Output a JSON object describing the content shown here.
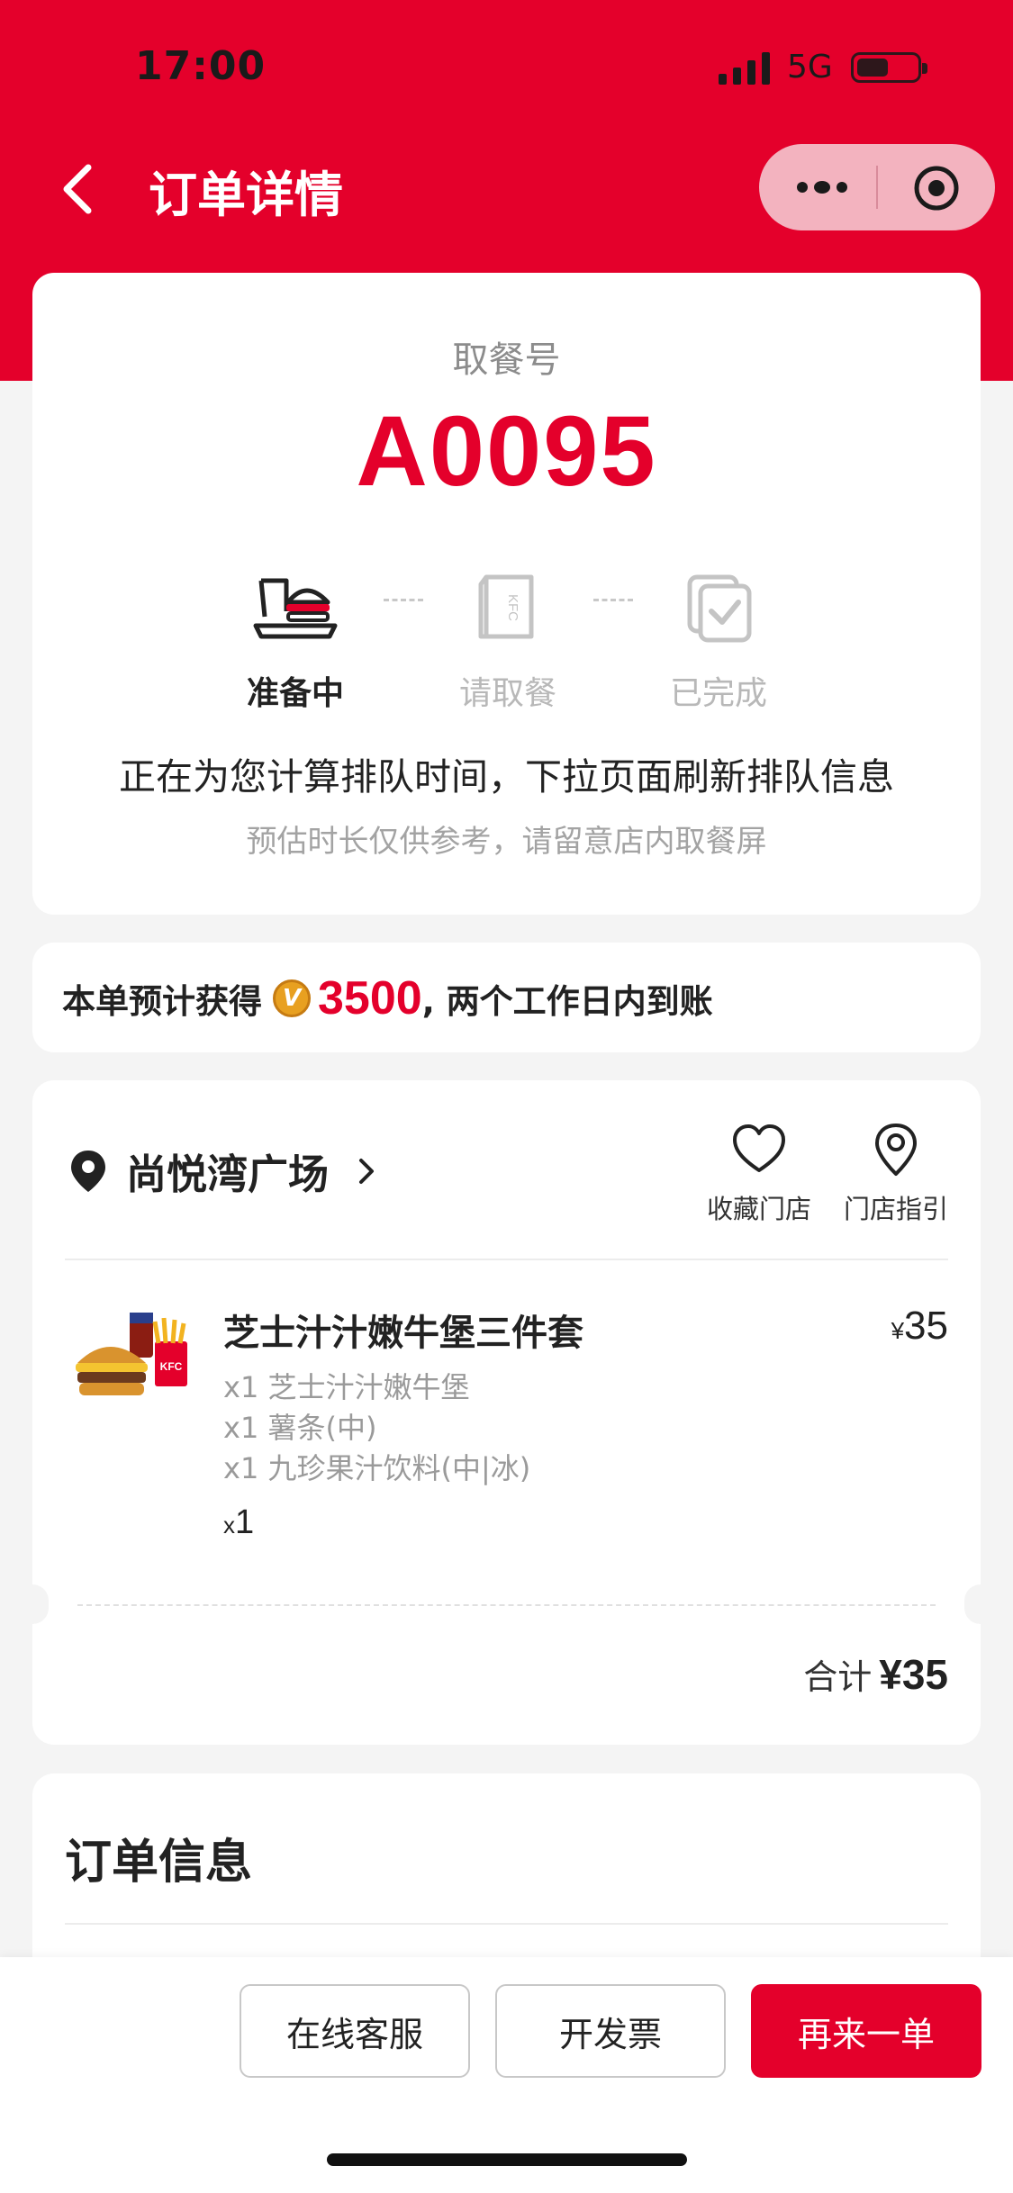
{
  "status_bar": {
    "time": "17:00",
    "network": "5G",
    "battery_icon": "battery-icon",
    "signal_icon": "signal-icon"
  },
  "nav": {
    "title": "订单详情",
    "back_icon": "chevron-left-icon",
    "more_icon": "more-dots-icon",
    "close_icon": "target-icon"
  },
  "pickup": {
    "label": "取餐号",
    "number": "A0095",
    "steps": [
      {
        "label": "准备中",
        "icon": "burger-tray-icon",
        "active": true
      },
      {
        "label": "请取餐",
        "icon": "kfc-bag-icon",
        "active": false
      },
      {
        "label": "已完成",
        "icon": "check-cup-icon",
        "active": false
      }
    ],
    "queue_message": "正在为您计算排队时间，下拉页面刷新排队信息",
    "queue_note": "预估时长仅供参考，请留意店内取餐屏"
  },
  "points": {
    "prefix": "本单预计获得",
    "coin_letter": "V",
    "amount": "3500",
    "suffix": ", 两个工作日内到账"
  },
  "store": {
    "name": "尚悦湾广场",
    "favorite_label": "收藏门店",
    "directions_label": "门店指引"
  },
  "order_item": {
    "name": "芝士汁汁嫩牛堡三件套",
    "price_symbol": "¥",
    "price": "35",
    "components": [
      "x1 芝士汁汁嫩牛堡",
      "x1 薯条(中)",
      "x1 九珍果汁饮料(中|冰)"
    ],
    "qty_prefix": "x",
    "qty": "1"
  },
  "total": {
    "label": "合计",
    "amount": "¥35"
  },
  "order_info": {
    "title": "订单信息"
  },
  "actions": {
    "service": "在线客服",
    "invoice": "开发票",
    "reorder": "再来一单"
  },
  "colors": {
    "brand_red": "#e4002b",
    "background": "#f4f4f4"
  }
}
